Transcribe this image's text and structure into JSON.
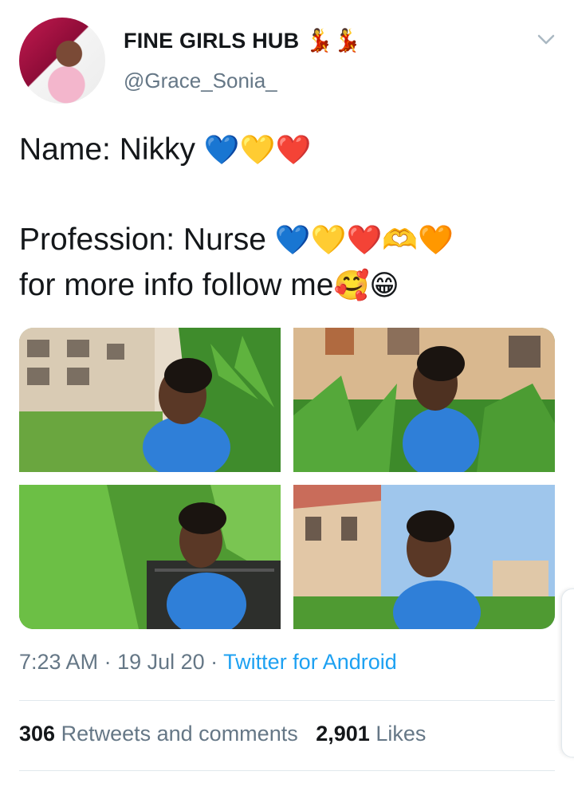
{
  "tweet": {
    "display_name": "FINE GIRLS HUB",
    "name_emojis": "💃💃",
    "handle": "@Grace_Sonia_",
    "line1_text": "Name: Nikky ",
    "line1_emojis": "💙💛❤️",
    "line2_text": "Profession: Nurse ",
    "line2_emojis": "💙💛❤️🫶🧡",
    "line3_text": "for more info follow me",
    "line3_emojis": "🥰😁",
    "time": "7:23 AM",
    "date": "19 Jul 20",
    "separator": " · ",
    "source": "Twitter for Android"
  },
  "stats": {
    "retweets_count": "306",
    "retweets_label": "Retweets and comments",
    "likes_count": "2,901",
    "likes_label": "Likes"
  },
  "icons": {
    "more": "chevron-down-icon"
  },
  "colors": {
    "link": "#1da1f2",
    "secondary_text": "#657786",
    "divider": "#e1e8ed",
    "scrub_blue": "#2f7fd8"
  }
}
